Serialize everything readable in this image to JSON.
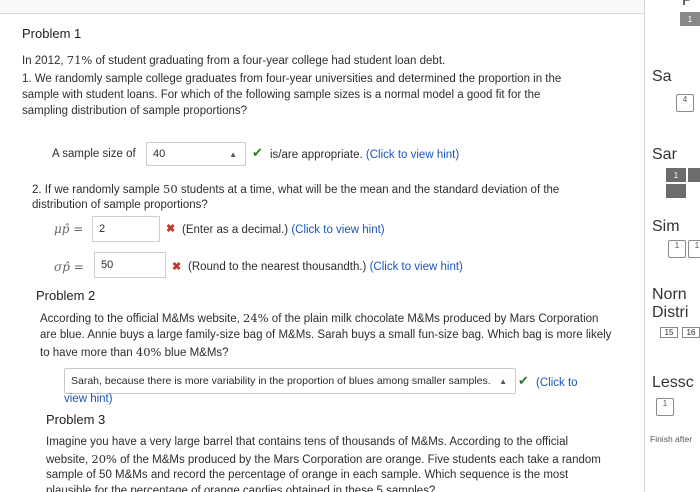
{
  "problem1": {
    "title": "Problem 1",
    "intro_a": "In 2012, ",
    "intro_pct": "71%",
    "intro_b": " of student graduating from a four-year college had student loan debt.",
    "q1_line1": "1. We randomly sample college graduates from four-year universities and determined the proportion in the",
    "q1_line2": "sample with student loans. For which of the following sample sizes is a normal model a good fit for the",
    "q1_line3": "sampling distribution of sample proportions?",
    "sample_label": "A sample size of",
    "sample_value": "40",
    "sample_after": "is/are appropriate.",
    "hint": "(Click to view hint)",
    "q2_line1_a": "2. If we randomly sample ",
    "q2_n": "50",
    "q2_line1_b": " students at a time, what will be the mean and the standard deviation of the",
    "q2_line2": "distribution of sample proportions?",
    "mu_label": "μp̂ =",
    "mu_value": "2",
    "mu_note": "(Enter as a decimal.)",
    "sigma_label": "σp̂ =",
    "sigma_value": "50",
    "sigma_note": "(Round to the nearest thousandth.)"
  },
  "problem2": {
    "title": "Problem 2",
    "line1_a": "According to the official M&Ms website, ",
    "line1_pct": "24%",
    "line1_b": " of the plain milk chocolate M&Ms produced by Mars Corporation",
    "line2": "are blue. Annie buys a large family-size bag of M&Ms. Sarah buys a small fun-size bag. Which bag is more likely",
    "line3_a": "to have more than ",
    "line3_pct": "40%",
    "line3_b": " blue M&Ms?",
    "answer": "Sarah, because there is more variability in the proportion of blues among smaller samples.",
    "hint_a": "(Click to",
    "hint_b": "view hint)"
  },
  "problem3": {
    "title": "Problem 3",
    "line1": "Imagine you have a very large barrel that contains tens of thousands of M&Ms. According to the official",
    "line2_a": "website, ",
    "line2_pct": "20%",
    "line2_b": " of the M&Ms produced by the Mars Corporation are orange. Five students each take a random",
    "line3": "sample of 50 M&Ms and record the percentage of orange in each sample. Which sequence is the most",
    "line4": "plausible for the percentage of orange candies obtained in these 5 samples?"
  },
  "sidebar": {
    "top_label": "P",
    "sa_label": "Sa",
    "sa_box": "4",
    "sar_label": "Sar",
    "sar_pill": "1",
    "sim_label": "Sim",
    "sim_box1": "1",
    "sim_box2": "1",
    "norm_label1": "Norn",
    "norm_label2": "Distri",
    "norm_box1": "15",
    "norm_box2": "16",
    "lesson_label": "Lessc",
    "lesson_box": "1",
    "finish": "Finish after"
  }
}
